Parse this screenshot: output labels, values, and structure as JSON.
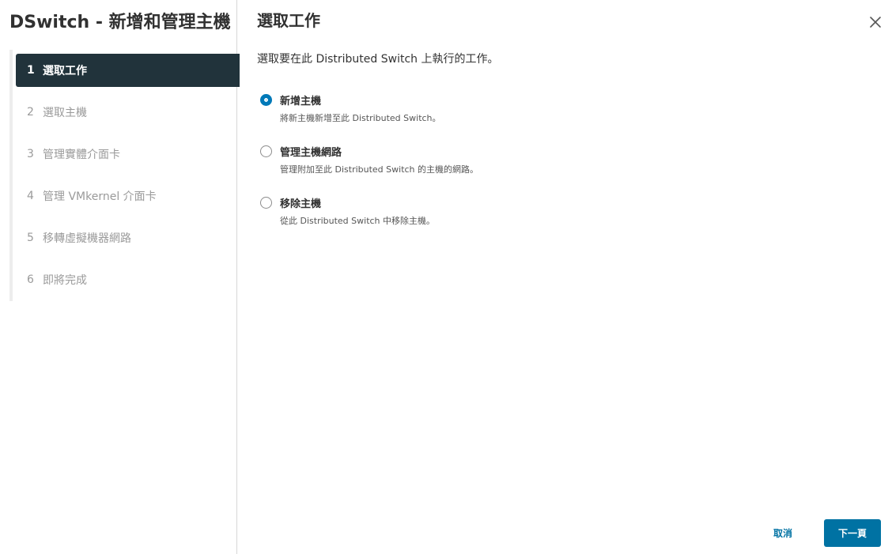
{
  "wizard": {
    "title": "DSwitch - 新增和管理主機"
  },
  "steps": [
    {
      "number": "1",
      "label": "選取工作",
      "active": true
    },
    {
      "number": "2",
      "label": "選取主機",
      "active": false
    },
    {
      "number": "3",
      "label": "管理實體介面卡",
      "active": false
    },
    {
      "number": "4",
      "label": "管理 VMkernel 介面卡",
      "active": false
    },
    {
      "number": "5",
      "label": "移轉虛擬機器網路",
      "active": false
    },
    {
      "number": "6",
      "label": "即將完成",
      "active": false
    }
  ],
  "main": {
    "title": "選取工作",
    "instruction": "選取要在此 Distributed Switch 上執行的工作。",
    "close_icon": "close-icon"
  },
  "options": [
    {
      "label": "新增主機",
      "description": "將新主機新增至此 Distributed Switch。",
      "selected": true
    },
    {
      "label": "管理主機網路",
      "description": "管理附加至此 Distributed Switch 的主機的網路。",
      "selected": false
    },
    {
      "label": "移除主機",
      "description": "從此 Distributed Switch 中移除主機。",
      "selected": false
    }
  ],
  "footer": {
    "cancel_label": "取消",
    "next_label": "下一頁"
  },
  "colors": {
    "active_step_bg": "#21333b",
    "primary": "#0072a3",
    "radio_selected": "#0079b8"
  }
}
